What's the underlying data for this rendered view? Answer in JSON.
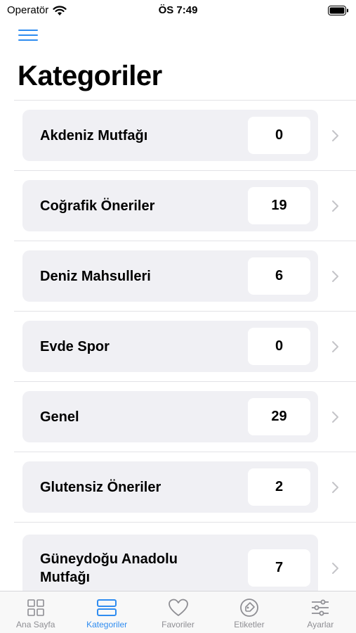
{
  "status_bar": {
    "carrier": "Operatör",
    "time": "ÖS 7:49"
  },
  "page_title": "Kategoriler",
  "categories": [
    {
      "name": "Akdeniz Mutfağı",
      "count": "0"
    },
    {
      "name": "Coğrafik Öneriler",
      "count": "19"
    },
    {
      "name": "Deniz Mahsulleri",
      "count": "6"
    },
    {
      "name": "Evde Spor",
      "count": "0"
    },
    {
      "name": "Genel",
      "count": "29"
    },
    {
      "name": "Glutensiz Öneriler",
      "count": "2"
    },
    {
      "name": "Güneydoğu Anadolu Mutfağı",
      "count": "7"
    }
  ],
  "tabs": [
    {
      "label": "Ana Sayfa",
      "icon": "grid-icon",
      "active": false
    },
    {
      "label": "Kategoriler",
      "icon": "list-icon",
      "active": true
    },
    {
      "label": "Favoriler",
      "icon": "heart-icon",
      "active": false
    },
    {
      "label": "Etiketler",
      "icon": "tag-icon",
      "active": false
    },
    {
      "label": "Ayarlar",
      "icon": "sliders-icon",
      "active": false
    }
  ],
  "colors": {
    "accent": "#2f8cf0",
    "inactive": "#8e8e93",
    "card": "#f0f0f4"
  }
}
